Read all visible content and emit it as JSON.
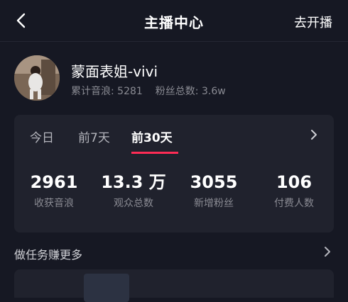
{
  "header": {
    "title": "主播中心",
    "action_label": "去开播"
  },
  "profile": {
    "username": "蒙面表姐-vivi",
    "total_yinlang": "累计音浪: 5281",
    "fans_total": "粉丝总数: 3.6w"
  },
  "tabs": [
    {
      "label": "今日",
      "active": false
    },
    {
      "label": "前7天",
      "active": false
    },
    {
      "label": "前30天",
      "active": true
    }
  ],
  "metrics": [
    {
      "value": "2961",
      "label": "收获音浪"
    },
    {
      "value": "13.3 万",
      "label": "观众总数"
    },
    {
      "value": "3055",
      "label": "新增粉丝"
    },
    {
      "value": "106",
      "label": "付费人数"
    }
  ],
  "tasks": {
    "label": "做任务赚更多"
  },
  "colors": {
    "background": "#161823",
    "card": "#20222d",
    "accent": "#fe2c55",
    "muted": "#8a8b93"
  },
  "icons": [
    "back-arrow-icon",
    "chevron-right-icon"
  ]
}
